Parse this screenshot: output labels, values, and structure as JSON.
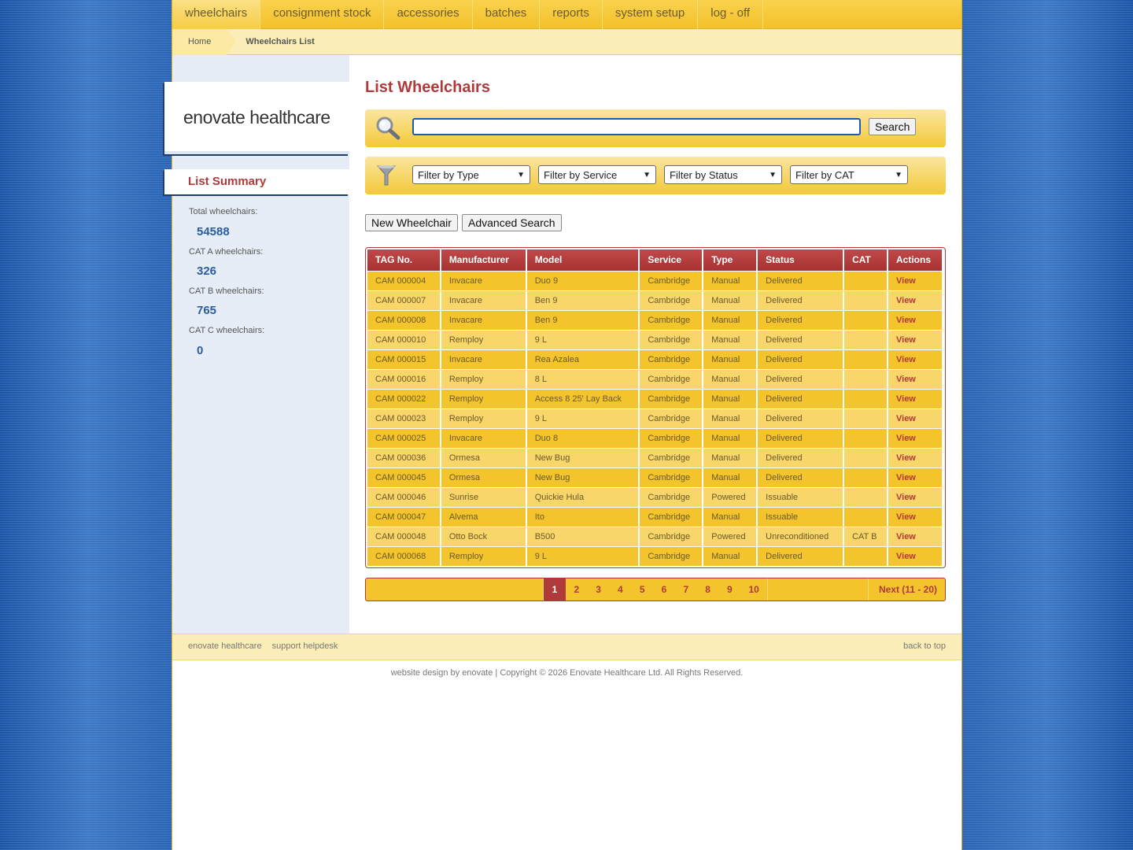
{
  "nav": {
    "items": [
      {
        "label": "wheelchairs",
        "active": true
      },
      {
        "label": "consignment stock",
        "active": false
      },
      {
        "label": "accessories",
        "active": false
      },
      {
        "label": "batches",
        "active": false
      },
      {
        "label": "reports",
        "active": false
      },
      {
        "label": "system setup",
        "active": false
      },
      {
        "label": "log - off",
        "active": false
      }
    ]
  },
  "breadcrumb": {
    "home": "Home",
    "current": "Wheelchairs List"
  },
  "sidebar": {
    "logo": "enovate healthcare",
    "summary_title": "List Summary",
    "stats": [
      {
        "label": "Total wheelchairs:",
        "value": "54588"
      },
      {
        "label": "CAT A wheelchairs:",
        "value": "326"
      },
      {
        "label": "CAT B wheelchairs:",
        "value": "765"
      },
      {
        "label": "CAT C wheelchairs:",
        "value": "0"
      }
    ]
  },
  "main": {
    "title": "List Wheelchairs",
    "search": {
      "value": "",
      "placeholder": "",
      "button": "Search",
      "icon": "magnifier-icon"
    },
    "filters": {
      "icon": "funnel-icon",
      "selects": [
        "Filter by Type",
        "Filter by Service",
        "Filter by Status",
        "Filter by CAT"
      ]
    },
    "buttons": {
      "new": "New Wheelchair",
      "advanced": "Advanced Search"
    }
  },
  "table": {
    "columns": [
      "TAG No.",
      "Manufacturer",
      "Model",
      "Service",
      "Type",
      "Status",
      "CAT",
      "Actions"
    ],
    "rows": [
      [
        "CAM 000004",
        "Invacare",
        "Duo 9",
        "Cambridge",
        "Manual",
        "Delivered",
        "",
        "View"
      ],
      [
        "CAM 000007",
        "Invacare",
        "Ben 9",
        "Cambridge",
        "Manual",
        "Delivered",
        "",
        "View"
      ],
      [
        "CAM 000008",
        "Invacare",
        "Ben 9",
        "Cambridge",
        "Manual",
        "Delivered",
        "",
        "View"
      ],
      [
        "CAM 000010",
        "Remploy",
        "9 L",
        "Cambridge",
        "Manual",
        "Delivered",
        "",
        "View"
      ],
      [
        "CAM 000015",
        "Invacare",
        "Rea Azalea",
        "Cambridge",
        "Manual",
        "Delivered",
        "",
        "View"
      ],
      [
        "CAM 000016",
        "Remploy",
        "8 L",
        "Cambridge",
        "Manual",
        "Delivered",
        "",
        "View"
      ],
      [
        "CAM 000022",
        "Remploy",
        "Access 8 25' Lay Back",
        "Cambridge",
        "Manual",
        "Delivered",
        "",
        "View"
      ],
      [
        "CAM 000023",
        "Remploy",
        "9 L",
        "Cambridge",
        "Manual",
        "Delivered",
        "",
        "View"
      ],
      [
        "CAM 000025",
        "Invacare",
        "Duo 8",
        "Cambridge",
        "Manual",
        "Delivered",
        "",
        "View"
      ],
      [
        "CAM 000036",
        "Ormesa",
        "New Bug",
        "Cambridge",
        "Manual",
        "Delivered",
        "",
        "View"
      ],
      [
        "CAM 000045",
        "Ormesa",
        "New Bug",
        "Cambridge",
        "Manual",
        "Delivered",
        "",
        "View"
      ],
      [
        "CAM 000046",
        "Sunrise",
        "Quickie Hula",
        "Cambridge",
        "Powered",
        "Issuable",
        "",
        "View"
      ],
      [
        "CAM 000047",
        "Alvema",
        "Ito",
        "Cambridge",
        "Manual",
        "Issuable",
        "",
        "View"
      ],
      [
        "CAM 000048",
        "Otto Bock",
        "B500",
        "Cambridge",
        "Powered",
        "Unreconditioned",
        "CAT B",
        "View"
      ],
      [
        "CAM 000068",
        "Remploy",
        "9 L",
        "Cambridge",
        "Manual",
        "Delivered",
        "",
        "View"
      ]
    ]
  },
  "pagination": {
    "pages": [
      "1",
      "2",
      "3",
      "4",
      "5",
      "6",
      "7",
      "8",
      "9",
      "10"
    ],
    "current": "1",
    "next": "Next (11 - 20)"
  },
  "footer": {
    "links": [
      "enovate healthcare",
      "support helpdesk"
    ],
    "back_to_top": "back to top",
    "copyright": "website design by enovate | Copyright © 2026 Enovate Healthcare Ltd. All Rights Reserved."
  },
  "colors": {
    "accent_red": "#b03a3a",
    "nav_yellow": "#f3c12b",
    "link_blue": "#2a5ca0",
    "background_blue": "#2a64b4"
  }
}
